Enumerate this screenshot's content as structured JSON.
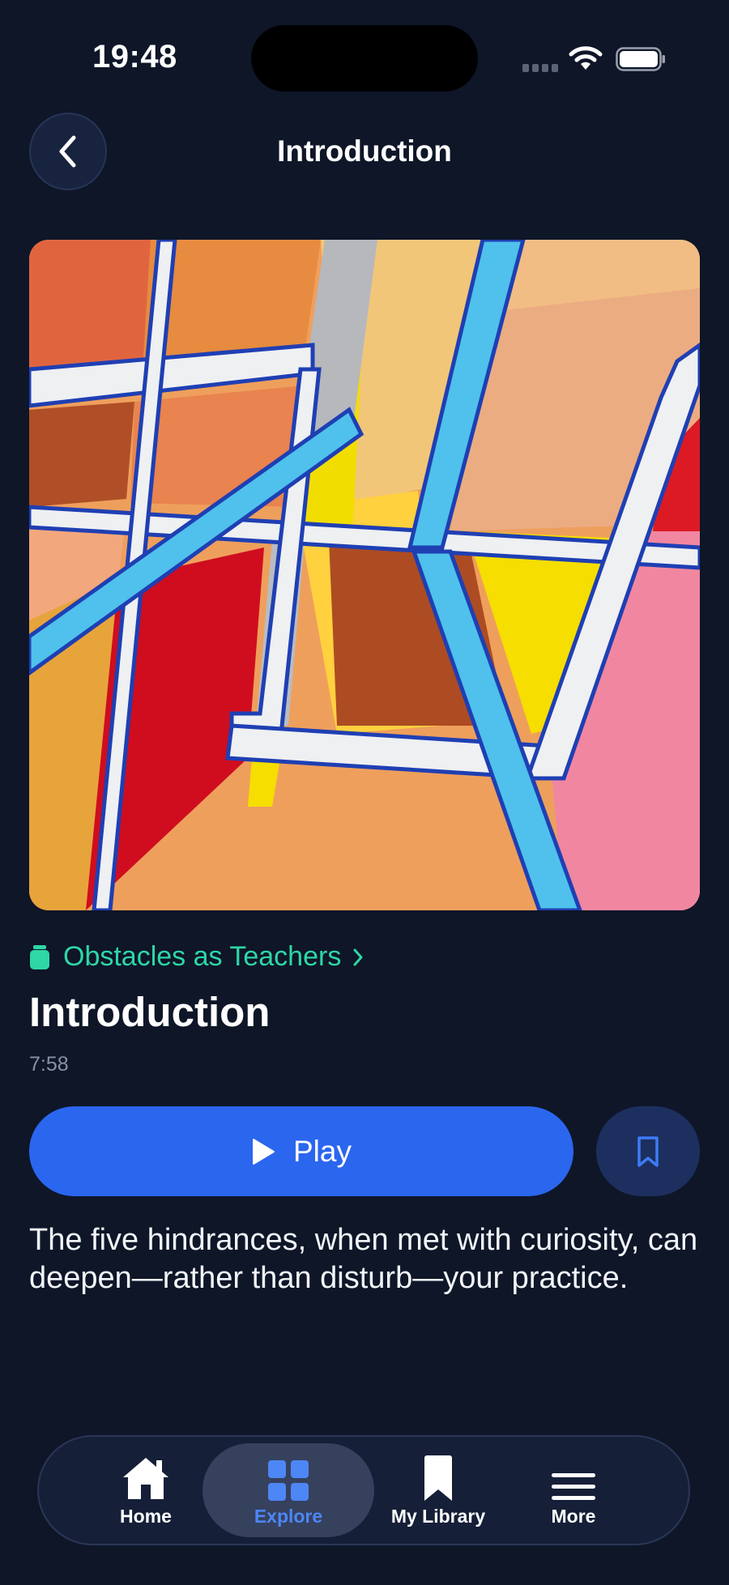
{
  "status_bar": {
    "time": "19:48"
  },
  "header": {
    "title": "Introduction"
  },
  "course": {
    "label": "Obstacles as Teachers"
  },
  "episode": {
    "title": "Introduction",
    "duration": "7:58",
    "description": "The five hindrances, when met with curiosity, can deepen—rather than disturb—your practice."
  },
  "actions": {
    "play_label": "Play"
  },
  "tab_bar": {
    "items": [
      {
        "label": "Home",
        "icon": "home-icon"
      },
      {
        "label": "Explore",
        "icon": "grid-icon",
        "active": true
      },
      {
        "label": "My Library",
        "icon": "bookmark-icon"
      },
      {
        "label": "More",
        "icon": "menu-icon"
      }
    ]
  },
  "colors": {
    "background": "#0e1628",
    "accent_blue": "#2b66ef",
    "accent_green": "#2fd6a6",
    "active_tab": "#4d86f5"
  }
}
